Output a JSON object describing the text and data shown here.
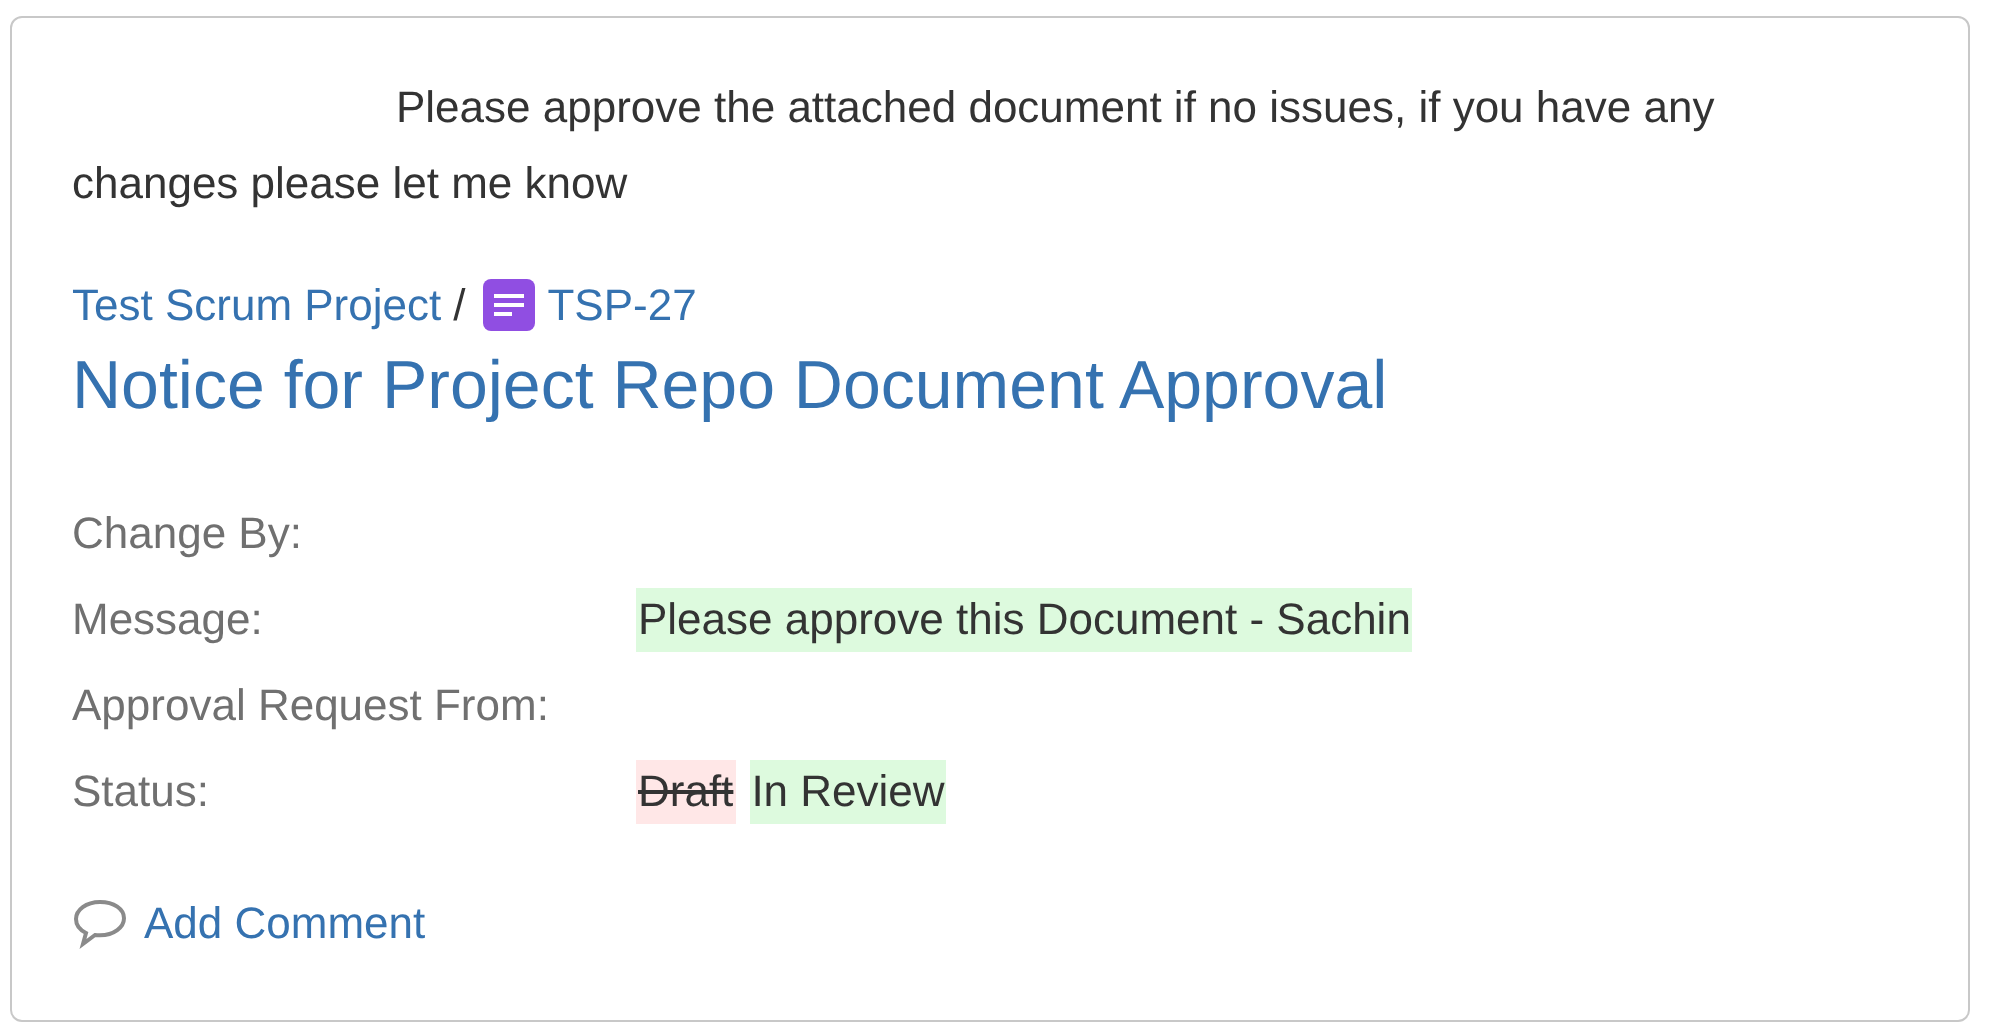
{
  "comment": "Please approve the attached document if no issues, if you have any changes please let me know",
  "breadcrumb": {
    "project": "Test Scrum Project",
    "separator": "/",
    "issue_key": "TSP-27"
  },
  "title": "Notice for Project Repo Document Approval",
  "fields": [
    {
      "label": "Change By:"
    },
    {
      "label": "Message:",
      "values": [
        {
          "kind": "added",
          "text": "Please approve this Document - Sachin"
        }
      ]
    },
    {
      "label": "Approval Request From:"
    },
    {
      "label": "Status:",
      "values": [
        {
          "kind": "removed",
          "text": "Draft"
        },
        {
          "kind": "added",
          "text": "In Review"
        }
      ]
    }
  ],
  "add_comment": "Add Comment"
}
